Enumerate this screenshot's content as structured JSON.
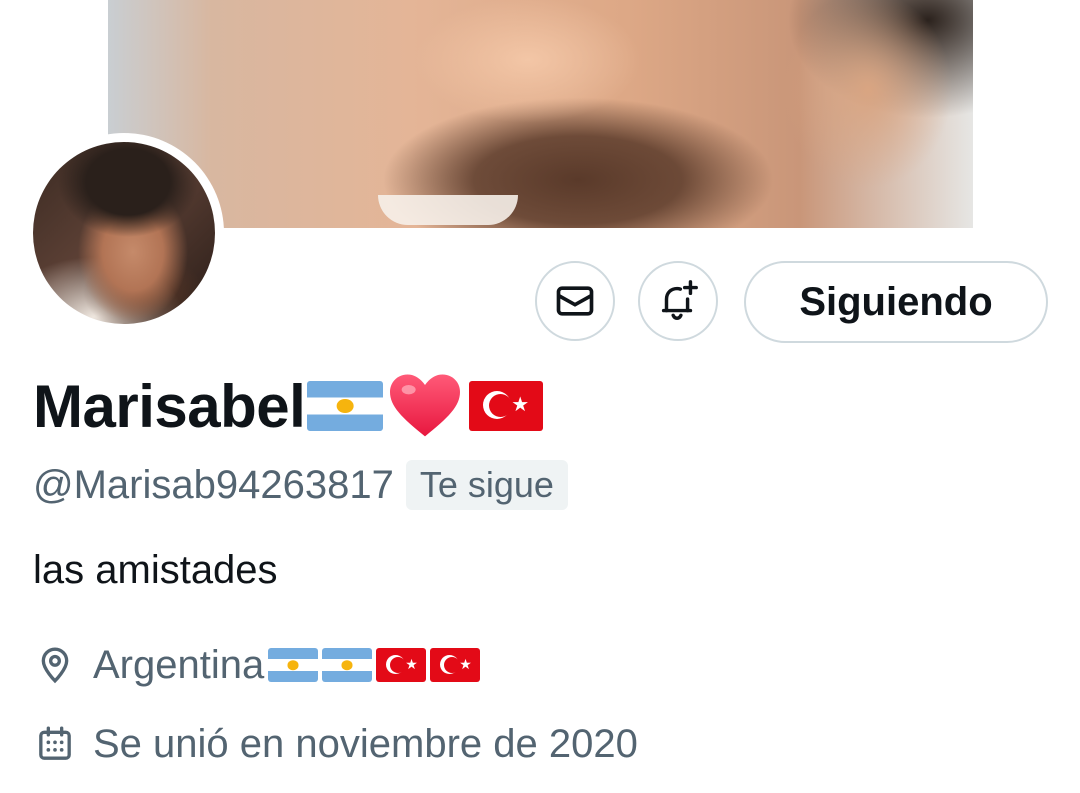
{
  "profile": {
    "name": "Marisabel",
    "handle": "@Marisab94263817",
    "follows_you_label": "Te sigue",
    "bio": "las amistades",
    "location": "Argentina",
    "joined": "Se unió en noviembre de 2020",
    "name_emoji": [
      "argentina-flag",
      "red-heart",
      "turkey-flag"
    ],
    "location_emoji": [
      "argentina-flag",
      "argentina-flag",
      "turkey-flag",
      "turkey-flag"
    ]
  },
  "actions": {
    "message_icon": "envelope-icon",
    "notify_icon": "bell-plus-icon",
    "following_label": "Siguiendo"
  },
  "colors": {
    "text_primary": "#0f1419",
    "text_secondary": "#536471",
    "border": "#cfd9de",
    "badge_bg": "#eff3f4"
  }
}
